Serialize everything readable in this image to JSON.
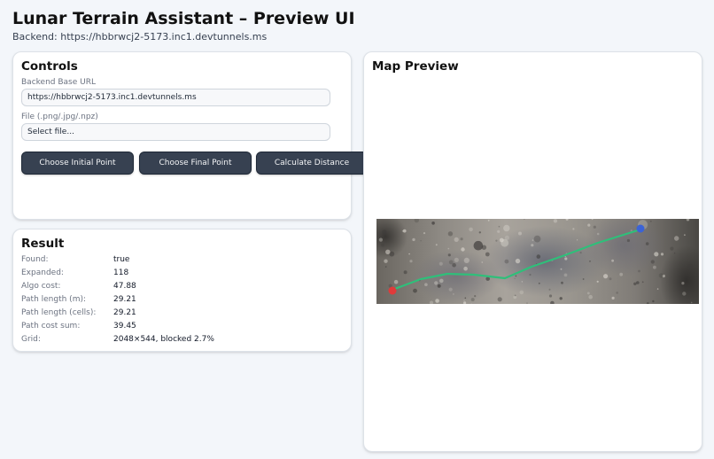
{
  "header": {
    "title": "Lunar Terrain Assistant – Preview UI",
    "backend_line": "Backend: https://hbbrwcj2-5173.inc1.devtunnels.ms"
  },
  "controls": {
    "title": "Controls",
    "url_label": "Backend Base URL",
    "url_value": "https://hbbrwcj2-5173.inc1.devtunnels.ms",
    "file_label": "File (.png/.jpg/.npz)",
    "file_button": "Select file...",
    "buttons": {
      "initial": "Choose Initial Point",
      "final": "Choose Final Point",
      "distance": "Calculate Distance"
    }
  },
  "result": {
    "title": "Result",
    "rows": [
      {
        "key": "Found:",
        "value": "true"
      },
      {
        "key": "Expanded:",
        "value": "118"
      },
      {
        "key": "Algo cost:",
        "value": "47.88"
      },
      {
        "key": "Path length (m):",
        "value": "29.21"
      },
      {
        "key": "Path length (cells):",
        "value": "29.21"
      },
      {
        "key": "Path cost sum:",
        "value": "39.45"
      },
      {
        "key": "Grid:",
        "value": "2048×544, blocked 2.7%"
      }
    ]
  },
  "map": {
    "title": "Map Preview",
    "path_color": "#2fbf7a",
    "start_marker_color": "#e03a3a",
    "end_marker_color": "#3b63d6"
  }
}
